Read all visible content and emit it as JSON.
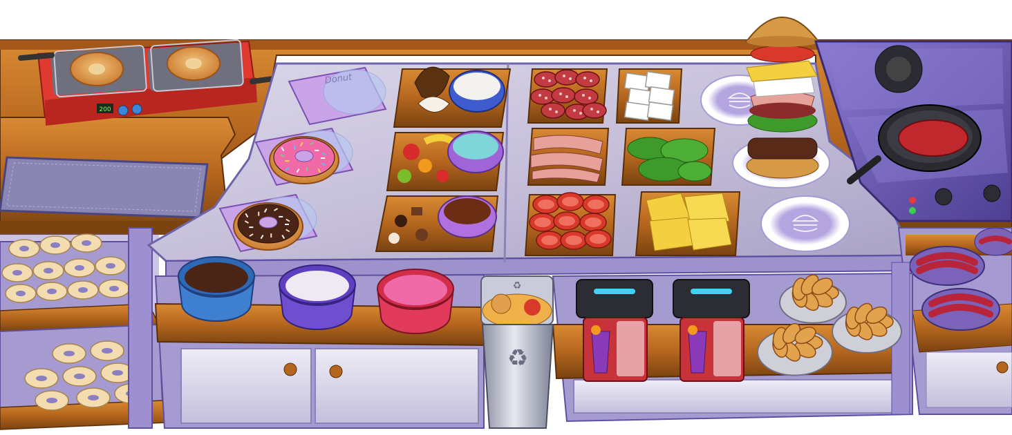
{
  "fryer": {
    "timer_text": "200"
  },
  "donut_boxes": [
    {
      "label": "Donut"
    }
  ],
  "palette": {
    "wood_dark": "#7a4310",
    "wood_mid": "#b5661e",
    "wood_light": "#d88a33",
    "counter_metal": "#c9c3dc",
    "counter_metal_light": "#dcd8ea",
    "purple_accent": "#7a63b8",
    "cabinet": "#d8d4e8",
    "fryer_red": "#e0392f",
    "stove_purple": "#6b5ab0",
    "glaze_pink": "#f06aa8",
    "glaze_chocolate": "#4a2416",
    "glaze_white": "#efeaf2",
    "tomato_red": "#d9392b",
    "cheese_yellow": "#f4d040",
    "lettuce_green": "#3f9a2c",
    "bun_tan": "#d69a46"
  },
  "icons": [
    "fryer-icon",
    "donut-icon",
    "donut-box-icon",
    "coconut-icon",
    "fruit-icon",
    "chocolate-icon",
    "salami-icon",
    "bread-slice-icon",
    "bacon-icon",
    "lettuce-icon",
    "tomato-icon",
    "cheese-icon",
    "burger-icon",
    "plate-icon",
    "pan-icon",
    "patty-icon",
    "stove-icon",
    "glaze-bowl-icon",
    "trash-can-icon",
    "recycle-icon",
    "juicer-icon",
    "bread-basket-icon",
    "sausage-icon",
    "shelf-icon"
  ]
}
